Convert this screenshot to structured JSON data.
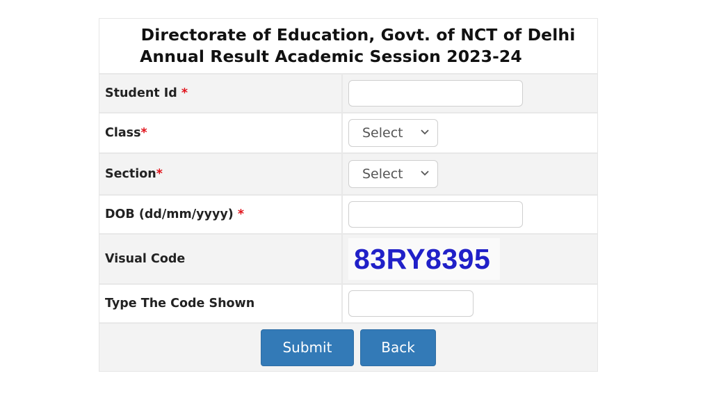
{
  "header": {
    "title_line1": "Directorate of Education, Govt. of NCT of Delhi",
    "title_line2": "Annual Result Academic Session 2023-24"
  },
  "form": {
    "required_marker": "*",
    "fields": [
      {
        "label": "Student Id ",
        "type": "text",
        "value": "",
        "required": true
      },
      {
        "label": "Class",
        "type": "select",
        "selected": "Select",
        "required": true
      },
      {
        "label": "Section",
        "type": "select",
        "selected": "Select",
        "required": true
      },
      {
        "label": "DOB (dd/mm/yyyy) ",
        "type": "text",
        "value": "",
        "required": true
      },
      {
        "label": "Visual Code",
        "type": "captcha",
        "value": "83RY8395",
        "required": false
      },
      {
        "label": "Type The Code Shown",
        "type": "text",
        "value": "",
        "required": false
      }
    ],
    "captcha_color": "#2020c8",
    "required_color": "#e0131b"
  },
  "buttons": {
    "submit_label": "Submit",
    "back_label": "Back",
    "color": "#337ab7"
  }
}
